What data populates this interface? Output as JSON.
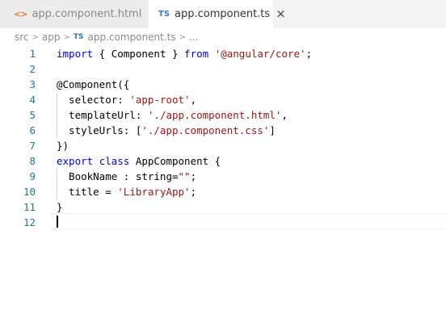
{
  "tabs": [
    {
      "icon": "<>",
      "label": "app.component.html",
      "active": false
    },
    {
      "icon": "TS",
      "label": "app.component.ts",
      "active": true,
      "close": "×"
    }
  ],
  "breadcrumb": {
    "parts": [
      "src",
      "app",
      "app.component.ts",
      "..."
    ],
    "separator": ">",
    "file_icon": "TS"
  },
  "editor": {
    "line_numbers": [
      "1",
      "2",
      "3",
      "4",
      "5",
      "6",
      "7",
      "8",
      "9",
      "10",
      "11",
      "12"
    ],
    "lines": [
      [
        {
          "t": "import",
          "c": "kw"
        },
        {
          "t": " { Component } "
        },
        {
          "t": "from",
          "c": "kw"
        },
        {
          "t": " "
        },
        {
          "t": "'@angular/core'",
          "c": "str"
        },
        {
          "t": ";"
        }
      ],
      [],
      [
        {
          "t": "@Component({"
        }
      ],
      [
        {
          "t": "  selector: "
        },
        {
          "t": "'app-root'",
          "c": "str"
        },
        {
          "t": ","
        }
      ],
      [
        {
          "t": "  templateUrl: "
        },
        {
          "t": "'./app.component.html'",
          "c": "str"
        },
        {
          "t": ","
        }
      ],
      [
        {
          "t": "  styleUrls: ["
        },
        {
          "t": "'./app.component.css'",
          "c": "str"
        },
        {
          "t": "]"
        }
      ],
      [
        {
          "t": "})"
        }
      ],
      [
        {
          "t": "export",
          "c": "kw"
        },
        {
          "t": " "
        },
        {
          "t": "class",
          "c": "kw"
        },
        {
          "t": " AppComponent {"
        }
      ],
      [
        {
          "t": "  BookName : string="
        },
        {
          "t": "\"\"",
          "c": "str"
        },
        {
          "t": ";"
        }
      ],
      [
        {
          "t": "  title = "
        },
        {
          "t": "'LibraryApp'",
          "c": "str"
        },
        {
          "t": ";"
        }
      ],
      [
        {
          "t": "}"
        }
      ],
      []
    ],
    "current_line": 12
  },
  "colors": {
    "keyword": "#0000ff",
    "string": "#a31515",
    "line_number": "#237893",
    "ts_icon": "#3178c6",
    "html_icon": "#e37933"
  }
}
